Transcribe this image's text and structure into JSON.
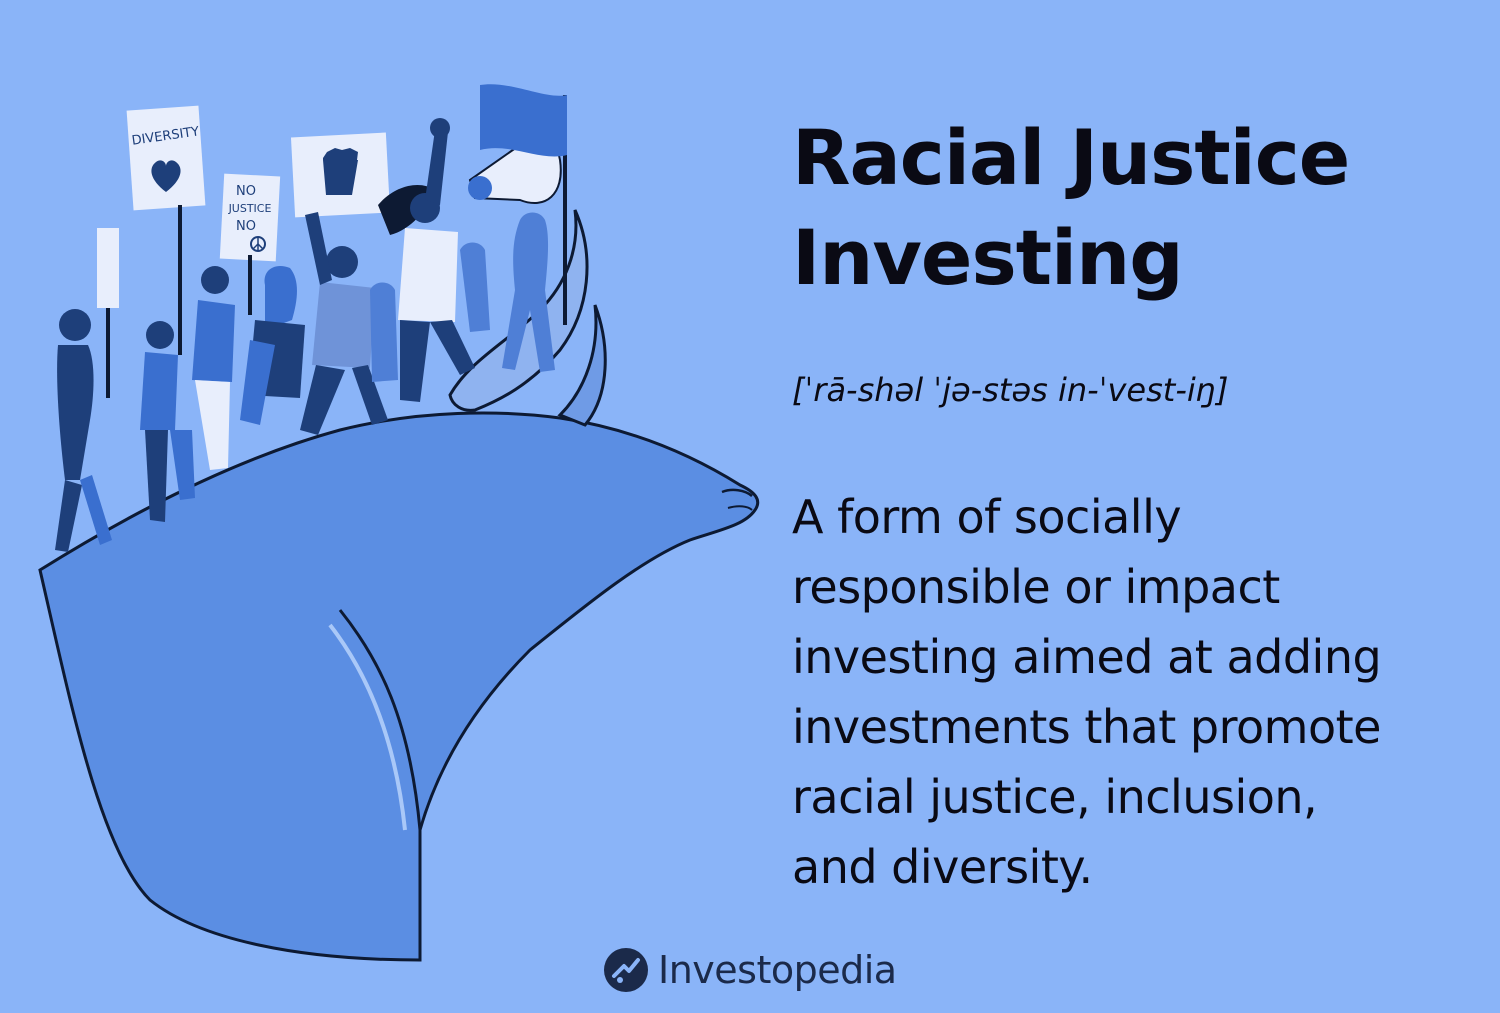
{
  "title": {
    "line1": "Racial Justice",
    "line2": "Investing"
  },
  "pronunciation": "[ˈrā-shəl ˈjə-stəs in-ˈvest-iŋ]",
  "definition": {
    "line1": "A form of socially",
    "line2": "responsible or impact",
    "line3": "investing aimed at adding",
    "line4": "investments that promote",
    "line5": "racial justice, inclusion,",
    "line6": "and diversity."
  },
  "signs": {
    "diversity": "DIVERSITY",
    "no": "NO",
    "justice": "JUSTICE",
    "no2": "NO"
  },
  "brand": {
    "name": "Investopedia"
  },
  "colors": {
    "background": "#8ab4f8",
    "bull": "#5b8ee3",
    "text": "#0a0a14",
    "people_dark": "#1e3f7a",
    "people_mid": "#3a6fcf"
  },
  "icons": [
    "heart-icon",
    "fist-icon",
    "peace-icon",
    "megaphone-icon",
    "flag-icon",
    "investopedia-logo-icon"
  ]
}
